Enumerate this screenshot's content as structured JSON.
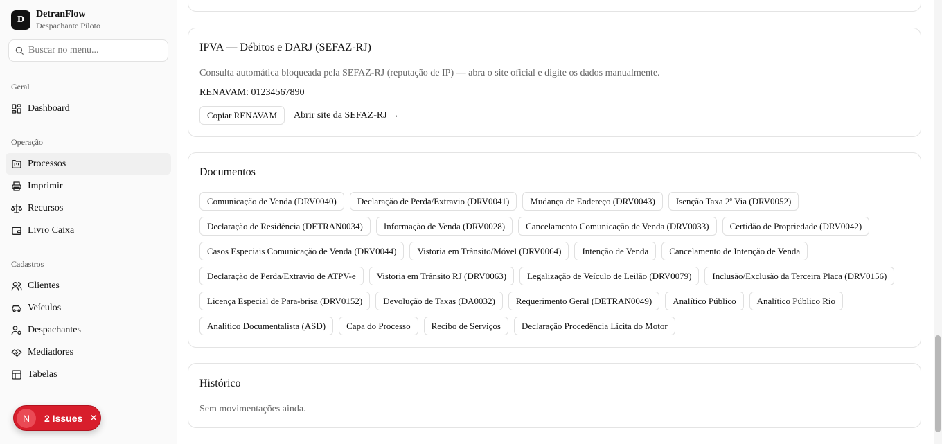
{
  "app": {
    "logo_letter": "D",
    "name": "DetranFlow",
    "subtitle": "Despachante Piloto"
  },
  "search": {
    "placeholder": "Buscar no menu..."
  },
  "sidebar": {
    "sections": [
      {
        "label": "Geral",
        "items": [
          {
            "label": "Dashboard",
            "icon": "dashboard-icon"
          }
        ]
      },
      {
        "label": "Operação",
        "items": [
          {
            "label": "Processos",
            "icon": "folder-kanban-icon",
            "active": true
          },
          {
            "label": "Imprimir",
            "icon": "printer-icon"
          },
          {
            "label": "Recursos",
            "icon": "scale-icon"
          },
          {
            "label": "Livro Caixa",
            "icon": "wallet-icon"
          }
        ]
      },
      {
        "label": "Cadastros",
        "items": [
          {
            "label": "Clientes",
            "icon": "users-icon"
          },
          {
            "label": "Veículos",
            "icon": "car-icon"
          },
          {
            "label": "Despachantes",
            "icon": "user-cog-icon"
          },
          {
            "label": "Mediadores",
            "icon": "handshake-icon"
          },
          {
            "label": "Tabelas",
            "icon": "table-icon"
          }
        ]
      }
    ]
  },
  "issues": {
    "avatar": "N",
    "label": "2 Issues",
    "close": "✕"
  },
  "ipva": {
    "title": "IPVA — Débitos e DARJ (SEFAZ-RJ)",
    "notice": "Consulta automática bloqueada pela SEFAZ-RJ (reputação de IP) — abra o site oficial e digite os dados manualmente.",
    "renavam": "RENAVAM: 01234567890",
    "copy_button": "Copiar RENAVAM",
    "open_link": "Abrir site da SEFAZ-RJ →"
  },
  "documents": {
    "title": "Documentos",
    "items": [
      "Comunicação de Venda (DRV0040)",
      "Declaração de Perda/Extravio (DRV0041)",
      "Mudança de Endereço (DRV0043)",
      "Isenção Taxa 2ª Via (DRV0052)",
      "Declaração de Residência (DETRAN0034)",
      "Informação de Venda (DRV0028)",
      "Cancelamento Comunicação de Venda (DRV0033)",
      "Certidão de Propriedade (DRV0042)",
      "Casos Especiais Comunicação de Venda (DRV0044)",
      "Vistoria em Trânsito/Móvel (DRV0064)",
      "Intenção de Venda",
      "Cancelamento de Intenção de Venda",
      "Declaração de Perda/Extravio de ATPV-e",
      "Vistoria em Trânsito RJ (DRV0063)",
      "Legalização de Veículo de Leilão (DRV0079)",
      "Inclusão/Exclusão da Terceira Placa (DRV0156)",
      "Licença Especial de Para-brisa (DRV0152)",
      "Devolução de Taxas (DA0032)",
      "Requerimento Geral (DETRAN0049)",
      "Analítico Público",
      "Analítico Público Rio",
      "Analítico Documentalista (ASD)",
      "Capa do Processo",
      "Recibo de Serviços",
      "Declaração Procedência Lícita do Motor"
    ]
  },
  "history": {
    "title": "Histórico",
    "empty": "Sem movimentações ainda."
  }
}
